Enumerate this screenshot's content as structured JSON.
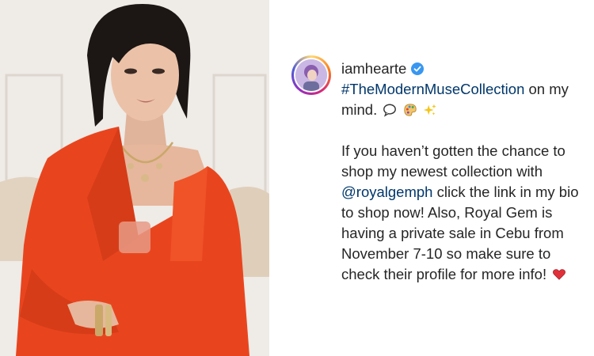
{
  "post": {
    "username": "iamhearte",
    "hashtag": "#TheModernMuseCollection",
    "line1_rest": " on my",
    "line2": "mind. ",
    "body_part1": "If you haven’t gotten the chance to shop my newest collection with ",
    "mention": "@royalgemph",
    "body_part2": " click the link in my bio to shop now! Also, Royal Gem is having a private sale in Cebu from November 7-10 so make sure to check their profile for more info! ",
    "emojis": [
      "speech-bubble",
      "artist-palette",
      "sparkles",
      "red-heart"
    ]
  },
  "colors": {
    "link": "#00376b",
    "verified": "#3897f0",
    "outfit": "#e8451f"
  }
}
